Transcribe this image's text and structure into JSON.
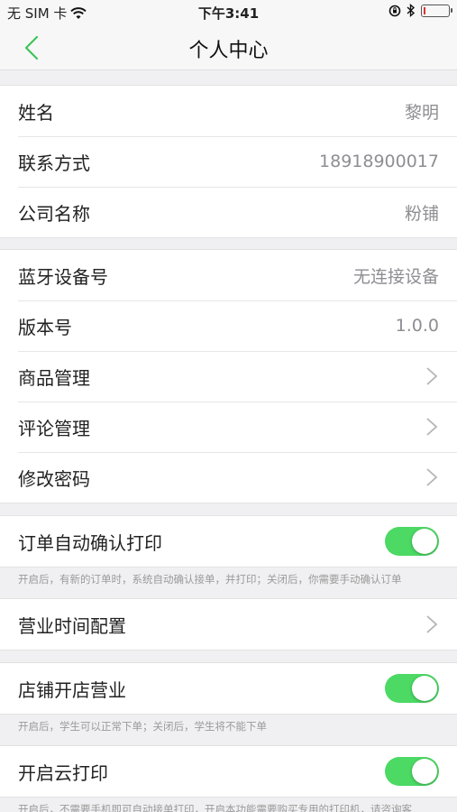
{
  "status_bar": {
    "carrier": "无 SIM 卡",
    "time": "下午3:41",
    "battery_level": 0.08,
    "icons": [
      "wifi-icon",
      "orientation-lock-icon",
      "bluetooth-icon",
      "battery-icon"
    ]
  },
  "nav": {
    "title": "个人中心",
    "back_icon": "chevron-left-icon"
  },
  "colors": {
    "accent_green": "#4cd964",
    "back_green": "#3ec45c",
    "battery_low": "#e03030"
  },
  "profile": {
    "name_label": "姓名",
    "name_value": "黎明",
    "contact_label": "联系方式",
    "contact_value": "18918900017",
    "company_label": "公司名称",
    "company_value": "粉铺"
  },
  "device": {
    "bluetooth_label": "蓝牙设备号",
    "bluetooth_value": "无连接设备",
    "version_label": "版本号",
    "version_value": "1.0.0",
    "goods_label": "商品管理",
    "comments_label": "评论管理",
    "password_label": "修改密码"
  },
  "auto_print": {
    "label": "订单自动确认打印",
    "enabled": true,
    "hint": "开启后，有新的订单时，系统自动确认接单，并打印；关闭后，你需要手动确认订单"
  },
  "business_hours": {
    "label": "营业时间配置"
  },
  "store_open": {
    "label": "店铺开店营业",
    "enabled": true,
    "hint": "开启后，学生可以正常下单；关闭后，学生将不能下单"
  },
  "cloud_print": {
    "label": "开启云打印",
    "enabled": true,
    "hint": "开启后，不需要手机即可自动接单打印，开启本功能需要购买专用的打印机，请咨询客"
  }
}
